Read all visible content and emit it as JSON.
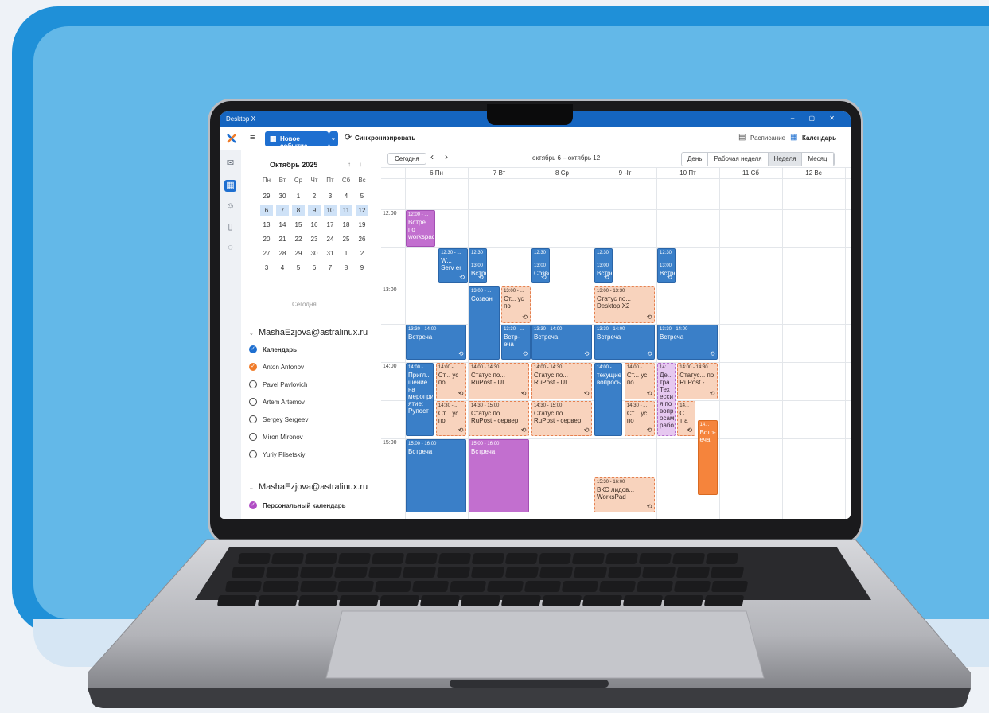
{
  "app": {
    "title": "Desktop X",
    "window_controls": "– ▢ ✕"
  },
  "toolbar": {
    "new_event": "Новое событие",
    "sync": "Синхронизировать",
    "schedule": "Расписание",
    "calendar": "Календарь"
  },
  "minical": {
    "month": "Октябрь 2025",
    "weekdays": [
      "Пн",
      "Вт",
      "Ср",
      "Чт",
      "Пт",
      "Сб",
      "Вс"
    ],
    "weeks": [
      [
        "29",
        "30",
        "1",
        "2",
        "3",
        "4",
        "5"
      ],
      [
        "6",
        "7",
        "8",
        "9",
        "10",
        "11",
        "12"
      ],
      [
        "13",
        "14",
        "15",
        "16",
        "17",
        "18",
        "19"
      ],
      [
        "20",
        "21",
        "22",
        "23",
        "24",
        "25",
        "26"
      ],
      [
        "27",
        "28",
        "29",
        "30",
        "31",
        "1",
        "2"
      ],
      [
        "3",
        "4",
        "5",
        "6",
        "7",
        "8",
        "9"
      ]
    ],
    "today": "Сегодня"
  },
  "accounts": [
    {
      "email": "MashaEzjova@astralinux.ru",
      "calendars": [
        {
          "name": "Календарь",
          "color": "#1e6fd0",
          "checked": true
        },
        {
          "name": "Anton Antonov",
          "color": "#f07c2a",
          "checked": true
        },
        {
          "name": "Pavel Pavlovich",
          "color": "#444444",
          "checked": false
        },
        {
          "name": "Artem Artemov",
          "color": "#444444",
          "checked": false
        },
        {
          "name": "Sergey Sergeev",
          "color": "#444444",
          "checked": false
        },
        {
          "name": "Miron Mironov",
          "color": "#444444",
          "checked": false
        },
        {
          "name": "Yuriy Plisetskiy",
          "color": "#444444",
          "checked": false
        }
      ]
    },
    {
      "email": "MashaEzjova@astralinux.ru",
      "calendars": [
        {
          "name": "Персональный календарь",
          "color": "#b04cc4",
          "checked": true
        }
      ]
    }
  ],
  "calendar": {
    "today_btn": "Сегодня",
    "range": "октябрь 6 – октябрь 12",
    "views": [
      "День",
      "Рабочая неделя",
      "Неделя",
      "Месяц"
    ],
    "active_view": "Неделя",
    "days": [
      "6 Пн",
      "7 Вт",
      "8 Ср",
      "9 Чт",
      "10 Пт",
      "11 Сб",
      "12 Вс"
    ],
    "hours": [
      "12:00",
      "13:00",
      "14:00",
      "15:00"
    ]
  },
  "events": [
    {
      "time": "12:00 - ...",
      "title": "Встре... по workspad",
      "style": "purple"
    },
    {
      "time": "12:30 - ...",
      "title": "W... Serv er",
      "style": "blue",
      "recurring": true
    },
    {
      "time": "12:30 - 13:00",
      "title": "Встреча",
      "style": "blue",
      "recurring": true
    },
    {
      "time": "12:30 - 13:00",
      "title": "Созвон",
      "style": "blue",
      "recurring": true
    },
    {
      "time": "12:30 - 13:00",
      "title": "Встреча",
      "style": "blue",
      "recurring": true
    },
    {
      "time": "12:30 - 13:00",
      "title": "Встреча",
      "style": "blue",
      "recurring": true
    },
    {
      "time": "13:00 - ...",
      "title": "Созвон",
      "style": "blue"
    },
    {
      "time": "13:00 - ...",
      "title": "Ст... ус по",
      "style": "peach",
      "recurring": true
    },
    {
      "time": "13:00 - 13:30",
      "title": "Статус по... Desktop X2",
      "style": "peach",
      "recurring": true
    },
    {
      "time": "13:30 - 14:00",
      "title": "Встреча",
      "style": "blue",
      "recurring": true
    },
    {
      "time": "13:30 - ...",
      "title": "Встр- еча",
      "style": "blue",
      "recurring": true
    },
    {
      "time": "13:30 - 14:00",
      "title": "Встреча",
      "style": "blue",
      "recurring": true
    },
    {
      "time": "13:30 - 14:00",
      "title": "Встреча",
      "style": "blue",
      "recurring": true
    },
    {
      "time": "13:30 - 14:00",
      "title": "Встреча",
      "style": "blue",
      "recurring": true
    },
    {
      "time": "14:00 - ...",
      "title": "Пригл... шение на меропри ятие: Рупост",
      "style": "blue"
    },
    {
      "time": "14:00 - ...",
      "title": "Ст... ус по",
      "style": "peach",
      "recurring": true
    },
    {
      "time": "14:00 - 14:30",
      "title": "Статус по... RuPost - UI",
      "style": "peach",
      "recurring": true
    },
    {
      "time": "14:00 - 14:30",
      "title": "Статус по... RuPost - UI",
      "style": "peach",
      "recurring": true
    },
    {
      "time": "14:00 - ...",
      "title": "текущие вопросы",
      "style": "blue"
    },
    {
      "time": "14:00 - ...",
      "title": "Ст... ус по",
      "style": "peach",
      "recurring": true
    },
    {
      "time": "14:...",
      "title": "Де... тра. Тех есси я по вопр осам рабо",
      "style": "lilac"
    },
    {
      "time": "14:00 - 14:30",
      "title": "Статус... по RuPost -",
      "style": "peach",
      "recurring": true
    },
    {
      "time": "14:30 - ...",
      "title": "Ст... ус по",
      "style": "peach",
      "recurring": true
    },
    {
      "time": "14:30 - 15:00",
      "title": "Статус по... RuPost - сервер",
      "style": "peach",
      "recurring": true
    },
    {
      "time": "14:30 - 15:00",
      "title": "Статус по... RuPost - сервер",
      "style": "peach",
      "recurring": true
    },
    {
      "time": "14:30 - ...",
      "title": "Ст... ус по",
      "style": "peach",
      "recurring": true
    },
    {
      "time": "14...",
      "title": "С... т а",
      "style": "peach",
      "recurring": true
    },
    {
      "time": "14...",
      "title": "Встр- еча",
      "style": "orange"
    },
    {
      "time": "15:00 - 16:00",
      "title": "Встреча",
      "style": "blue"
    },
    {
      "time": "15:00 - 16:00",
      "title": "Встреча",
      "style": "purple"
    },
    {
      "time": "15:30 - 16:00",
      "title": "ВКС лидов... WorksPad",
      "style": "peach",
      "recurring": true
    }
  ],
  "colors": {
    "accent": "#1e6fd0",
    "background_dark": "#1f90d8",
    "background_light": "#63b8e8"
  }
}
